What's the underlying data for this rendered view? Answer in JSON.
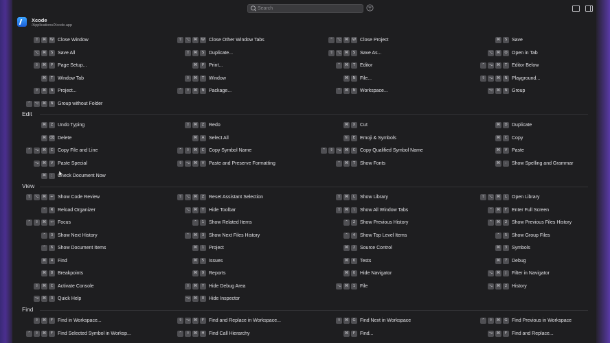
{
  "search": {
    "placeholder": "Search"
  },
  "app": {
    "name": "Xcode",
    "path": "/Applications/Xcode.app"
  },
  "sections": [
    {
      "title": "",
      "header_y": null,
      "rows": [
        [
          {
            "keys": [
              "⇧",
              "⌘",
              "W"
            ],
            "label": "Close Window"
          },
          {
            "keys": [
              "⇧",
              "⌥",
              "⌘",
              "W"
            ],
            "label": "Close Other Window Tabs"
          },
          {
            "keys": [
              "⌃",
              "⌥",
              "⌘",
              "W"
            ],
            "label": "Close Project"
          },
          {
            "keys": [
              "⌘",
              "S"
            ],
            "label": "Save"
          }
        ],
        [
          {
            "keys": [
              "⌥",
              "⌘",
              "S"
            ],
            "label": "Save All"
          },
          {
            "keys": [
              "⇧",
              "⌘",
              "S"
            ],
            "label": "Duplicate..."
          },
          {
            "keys": [
              "⇧",
              "⌥",
              "⌘",
              "S"
            ],
            "label": "Save As..."
          },
          {
            "keys": [
              "⌥",
              "⌘",
              "O"
            ],
            "label": "Open in Tab"
          }
        ],
        [
          {
            "keys": [
              "⇧",
              "⌘",
              "P"
            ],
            "label": "Page Setup..."
          },
          {
            "keys": [
              "⌘",
              "P"
            ],
            "label": "Print..."
          },
          {
            "keys": [
              "⌃",
              "⌘",
              "T"
            ],
            "label": "Editor"
          },
          {
            "keys": [
              "⌃",
              "⌥",
              "⌘",
              "T"
            ],
            "label": "Editor Below"
          }
        ],
        [
          {
            "keys": [
              "⌘",
              "T"
            ],
            "label": "Window Tab"
          },
          {
            "keys": [
              "⇧",
              "⌘",
              "T"
            ],
            "label": "Window"
          },
          {
            "keys": [
              "⌘",
              "N"
            ],
            "label": "File..."
          },
          {
            "keys": [
              "⇧",
              "⌥",
              "⌘",
              "N"
            ],
            "label": "Playground..."
          }
        ],
        [
          {
            "keys": [
              "⇧",
              "⌘",
              "N"
            ],
            "label": "Project..."
          },
          {
            "keys": [
              "⌃",
              "⇧",
              "⌘",
              "N"
            ],
            "label": "Package..."
          },
          {
            "keys": [
              "⌃",
              "⌘",
              "N"
            ],
            "label": "Workspace..."
          },
          {
            "keys": [
              "⌥",
              "⌘",
              "N"
            ],
            "label": "Group"
          }
        ],
        [
          {
            "keys": [
              "⌃",
              "⌥",
              "⌘",
              "N"
            ],
            "label": "Group without Folder"
          }
        ]
      ]
    },
    {
      "title": "Edit",
      "rows": [
        [
          {
            "keys": [
              "⌘",
              "Z"
            ],
            "label": "Undo Typing"
          },
          {
            "keys": [
              "⇧",
              "⌘",
              "Z"
            ],
            "label": "Redo"
          },
          {
            "keys": [
              "⌘",
              "X"
            ],
            "label": "Cut"
          },
          {
            "keys": [
              "⌘",
              "D"
            ],
            "label": "Duplicate"
          }
        ],
        [
          {
            "keys": [
              "⌘",
              "⌫"
            ],
            "label": "Delete"
          },
          {
            "keys": [
              "⌘",
              "A"
            ],
            "label": "Select All"
          },
          {
            "keys": [
              "fn",
              "E"
            ],
            "label": "Emoji & Symbols"
          },
          {
            "keys": [
              "⌘",
              "C"
            ],
            "label": "Copy"
          }
        ],
        [
          {
            "keys": [
              "⌃",
              "⌥",
              "⌘",
              "C"
            ],
            "label": "Copy File and Line"
          },
          {
            "keys": [
              "⌃",
              "⇧",
              "⌘",
              "C"
            ],
            "label": "Copy Symbol Name"
          },
          {
            "keys": [
              "⌃",
              "⇧",
              "⌥",
              "⌘",
              "C"
            ],
            "label": "Copy Qualified Symbol Name"
          },
          {
            "keys": [
              "⌘",
              "V"
            ],
            "label": "Paste"
          }
        ],
        [
          {
            "keys": [
              "⌥",
              "⌘",
              "V"
            ],
            "label": "Paste Special"
          },
          {
            "keys": [
              "⇧",
              "⌥",
              "⌘",
              "V"
            ],
            "label": "Paste and Preserve Formatting"
          },
          {
            "keys": [
              "⌃",
              "⌘",
              "T"
            ],
            "label": "Show Fonts"
          },
          {
            "keys": [
              "⌘",
              ":"
            ],
            "label": "Show Spelling and Grammar"
          }
        ],
        [
          {
            "keys": [
              "⌘",
              ";"
            ],
            "label": "Check Document Now"
          }
        ]
      ]
    },
    {
      "title": "View",
      "rows": [
        [
          {
            "keys": [
              "⇧",
              "⌥",
              "⌘",
              "↩"
            ],
            "label": "Show Code Review"
          },
          {
            "keys": [
              "⇧",
              "⌥",
              "⌘",
              "Z"
            ],
            "label": "Reset Assistant Selection"
          },
          {
            "keys": [
              "⇧",
              "⌘",
              "L"
            ],
            "label": "Show Library"
          },
          {
            "keys": [
              "⇧",
              "⌥",
              "⌘",
              "L"
            ],
            "label": "Open Library"
          }
        ],
        [
          {
            "keys": [
              "⌃",
              "R"
            ],
            "label": "Reload Organizer"
          },
          {
            "keys": [
              "⌥",
              "⌘",
              "T"
            ],
            "label": "Hide Toolbar"
          },
          {
            "keys": [
              "⇧",
              "⌘",
              "\\"
            ],
            "label": "Show All Window Tabs"
          },
          {
            "keys": [
              "⌃",
              "⌘",
              "F"
            ],
            "label": "Enter Full Screen"
          }
        ],
        [
          {
            "keys": [
              "⌃",
              "⇧",
              "⌘",
              "↩"
            ],
            "label": "Focus"
          },
          {
            "keys": [
              "⌃",
              "1"
            ],
            "label": "Show Related Items"
          },
          {
            "keys": [
              "⌃",
              "2"
            ],
            "label": "Show Previous History"
          },
          {
            "keys": [
              "⌃",
              "⌘",
              "2"
            ],
            "label": "Show Previous Files History"
          }
        ],
        [
          {
            "keys": [
              "⌃",
              "3"
            ],
            "label": "Show Next History"
          },
          {
            "keys": [
              "⌃",
              "⌘",
              "3"
            ],
            "label": "Show Next Files History"
          },
          {
            "keys": [
              "⌃",
              "4"
            ],
            "label": "Show Top Level Items"
          },
          {
            "keys": [
              "⌃",
              "5"
            ],
            "label": "Show Group Files"
          }
        ],
        [
          {
            "keys": [
              "⌃",
              "6"
            ],
            "label": "Show Document Items"
          },
          {
            "keys": [
              "⌘",
              "1"
            ],
            "label": "Project"
          },
          {
            "keys": [
              "⌘",
              "2"
            ],
            "label": "Source Control"
          },
          {
            "keys": [
              "⌘",
              "3"
            ],
            "label": "Symbols"
          }
        ],
        [
          {
            "keys": [
              "⌘",
              "4"
            ],
            "label": "Find"
          },
          {
            "keys": [
              "⌘",
              "5"
            ],
            "label": "Issues"
          },
          {
            "keys": [
              "⌘",
              "6"
            ],
            "label": "Tests"
          },
          {
            "keys": [
              "⌘",
              "7"
            ],
            "label": "Debug"
          }
        ],
        [
          {
            "keys": [
              "⌘",
              "8"
            ],
            "label": "Breakpoints"
          },
          {
            "keys": [
              "⌘",
              "9"
            ],
            "label": "Reports"
          },
          {
            "keys": [
              "⌘",
              "0"
            ],
            "label": "Hide Navigator"
          },
          {
            "keys": [
              "⌥",
              "⌘",
              "J"
            ],
            "label": "Filter in Navigator"
          }
        ],
        [
          {
            "keys": [
              "⇧",
              "⌘",
              "C"
            ],
            "label": "Activate Console"
          },
          {
            "keys": [
              "⇧",
              "⌘",
              "Y"
            ],
            "label": "Hide Debug Area"
          },
          {
            "keys": [
              "⌥",
              "⌘",
              "1"
            ],
            "label": "File"
          },
          {
            "keys": [
              "⌥",
              "⌘",
              "2"
            ],
            "label": "History"
          }
        ],
        [
          {
            "keys": [
              "⌥",
              "⌘",
              "3"
            ],
            "label": "Quick Help"
          },
          {
            "keys": [
              "⌥",
              "⌘",
              "0"
            ],
            "label": "Hide Inspector"
          }
        ]
      ]
    },
    {
      "title": "Find",
      "rows": [
        [
          {
            "keys": [
              "⇧",
              "⌘",
              "F"
            ],
            "label": "Find in Workspace..."
          },
          {
            "keys": [
              "⇧",
              "⌥",
              "⌘",
              "F"
            ],
            "label": "Find and Replace in Workspace..."
          },
          {
            "keys": [
              "⇧",
              "⌘",
              "G"
            ],
            "label": "Find Next in Workspace"
          },
          {
            "keys": [
              "⌃",
              "⇧",
              "⌘",
              "G"
            ],
            "label": "Find Previous in Workspace"
          }
        ],
        [
          {
            "keys": [
              "⌃",
              "⇧",
              "⌘",
              "F"
            ],
            "label": "Find Selected Symbol in Worksp..."
          },
          {
            "keys": [
              "⌃",
              "⇧",
              "⌘",
              "H"
            ],
            "label": "Find Call Hierarchy"
          },
          {
            "keys": [
              "⌘",
              "F"
            ],
            "label": "Find..."
          },
          {
            "keys": [
              "⌥",
              "⌘",
              "F"
            ],
            "label": "Find and Replace..."
          }
        ]
      ]
    }
  ]
}
